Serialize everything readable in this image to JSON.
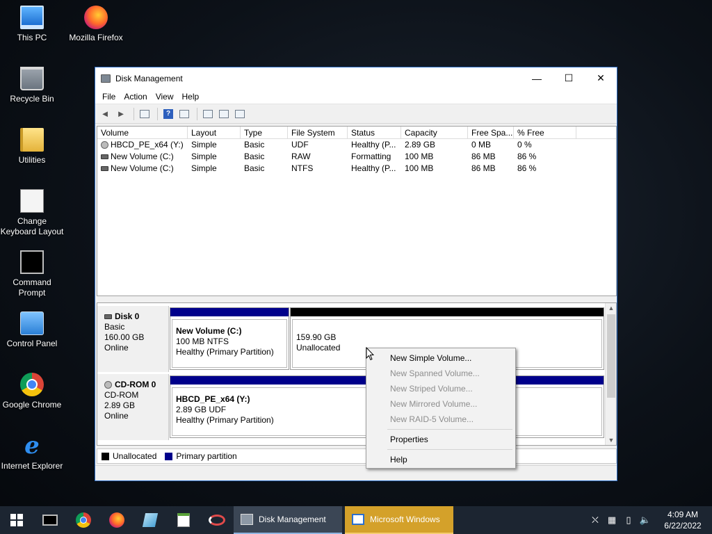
{
  "desktop": {
    "icons": [
      {
        "label": "This PC"
      },
      {
        "label": "Mozilla Firefox"
      },
      {
        "label": "Recycle Bin"
      },
      {
        "label": "Utilities"
      },
      {
        "label": "Change Keyboard Layout"
      },
      {
        "label": "Command Prompt"
      },
      {
        "label": "Control Panel"
      },
      {
        "label": "Google Chrome"
      },
      {
        "label": "Internet Explorer"
      }
    ]
  },
  "window": {
    "title": "Disk Management",
    "controls": {
      "minimize": "—",
      "maximize": "☐",
      "close": "✕"
    },
    "menu": [
      "File",
      "Action",
      "View",
      "Help"
    ],
    "toolbar": {
      "back": "◄",
      "forward": "►",
      "help": "?"
    }
  },
  "volumes": {
    "headers": [
      "Volume",
      "Layout",
      "Type",
      "File System",
      "Status",
      "Capacity",
      "Free Spa...",
      "% Free"
    ],
    "rows": [
      {
        "volume": "HBCD_PE_x64 (Y:)",
        "layout": "Simple",
        "type": "Basic",
        "fs": "UDF",
        "status": "Healthy (P...",
        "capacity": "2.89 GB",
        "free": "0 MB",
        "pct": "0 %"
      },
      {
        "volume": "New Volume (C:)",
        "layout": "Simple",
        "type": "Basic",
        "fs": "RAW",
        "status": "Formatting",
        "capacity": "100 MB",
        "free": "86 MB",
        "pct": "86 %"
      },
      {
        "volume": "New Volume (C:)",
        "layout": "Simple",
        "type": "Basic",
        "fs": "NTFS",
        "status": "Healthy (P...",
        "capacity": "100 MB",
        "free": "86 MB",
        "pct": "86 %"
      }
    ]
  },
  "disks": [
    {
      "name": "Disk 0",
      "type": "Basic",
      "size": "160.00 GB",
      "state": "Online",
      "partitions": [
        {
          "name": "New Volume  (C:)",
          "detail": "100 MB NTFS",
          "status": "Healthy (Primary Partition)"
        },
        {
          "name": "",
          "detail": "159.90 GB",
          "status": "Unallocated"
        }
      ]
    },
    {
      "name": "CD-ROM 0",
      "type": "CD-ROM",
      "size": "2.89 GB",
      "state": "Online",
      "partitions": [
        {
          "name": "HBCD_PE_x64  (Y:)",
          "detail": "2.89 GB UDF",
          "status": "Healthy (Primary Partition)"
        }
      ]
    }
  ],
  "legend": {
    "unallocated": "Unallocated",
    "primary": "Primary partition"
  },
  "colors": {
    "primary": "#00008b",
    "unallocated": "#000000",
    "accent": "#2b6cc4",
    "flash": "#d4a12a"
  },
  "context_menu": {
    "items": [
      {
        "label": "New Simple Volume...",
        "enabled": true
      },
      {
        "label": "New Spanned Volume...",
        "enabled": false
      },
      {
        "label": "New Striped Volume...",
        "enabled": false
      },
      {
        "label": "New Mirrored Volume...",
        "enabled": false
      },
      {
        "label": "New RAID-5 Volume...",
        "enabled": false
      },
      {
        "label": "Properties",
        "enabled": true
      },
      {
        "label": "Help",
        "enabled": true
      }
    ]
  },
  "taskbar": {
    "tasks": [
      {
        "label": "Disk Management"
      },
      {
        "label": "Microsoft Windows"
      }
    ],
    "clock": {
      "time": "4:09 AM",
      "date": "6/22/2022"
    }
  }
}
